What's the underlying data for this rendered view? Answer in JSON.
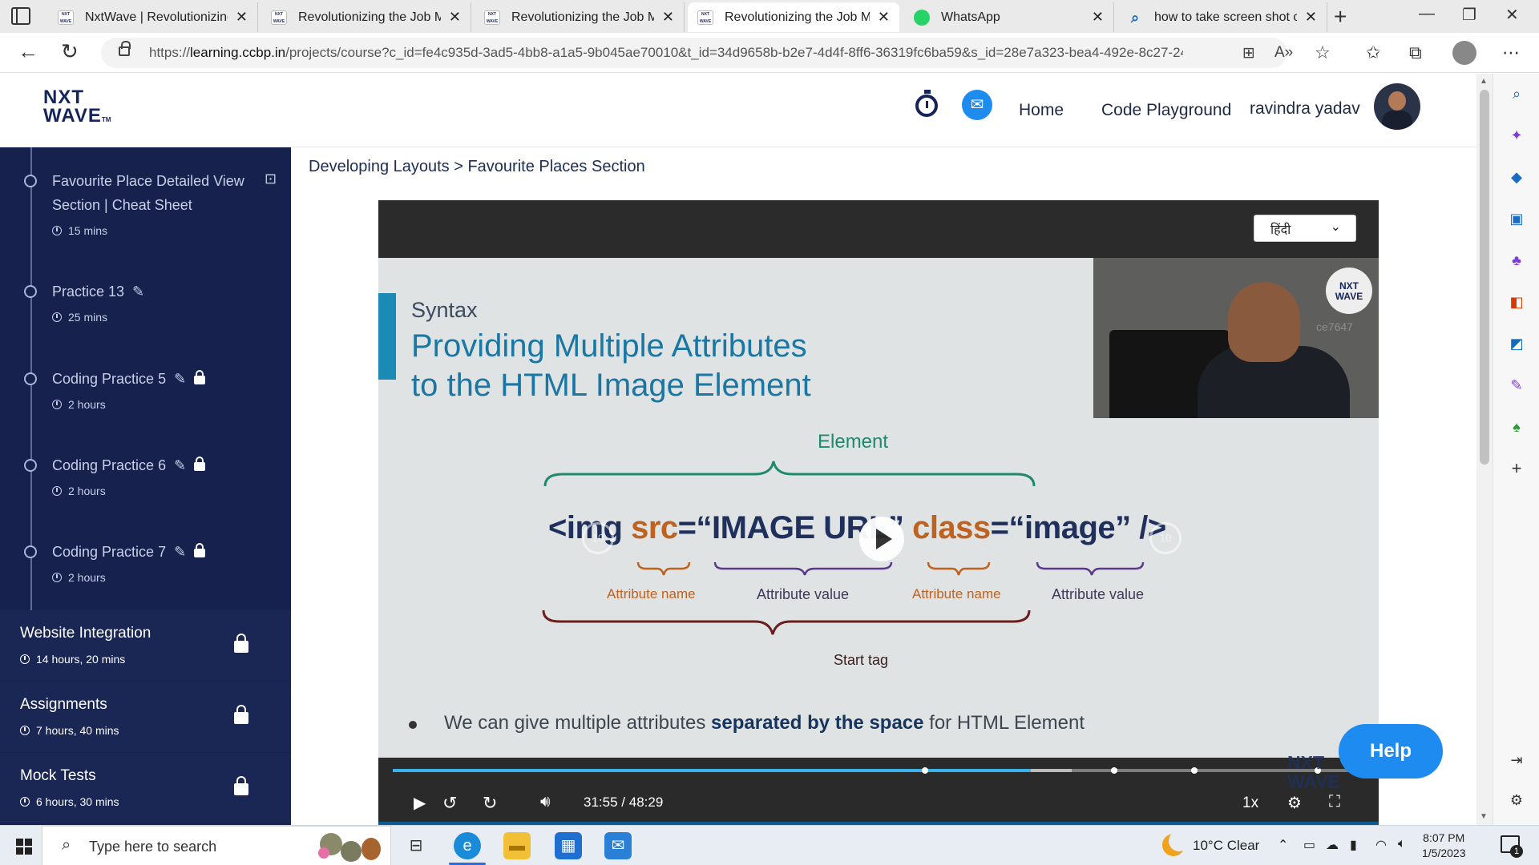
{
  "browser": {
    "tabs": [
      {
        "title": "NxtWave | Revolutionizing th",
        "active": false
      },
      {
        "title": "Revolutionizing the Job Mar",
        "active": false
      },
      {
        "title": "Revolutionizing the Job Mar",
        "active": false
      },
      {
        "title": "Revolutionizing the Job Mar",
        "active": true
      },
      {
        "title": "WhatsApp",
        "active": false
      },
      {
        "title": "how to take screen shot on",
        "active": false
      }
    ],
    "url_prefix": "https://",
    "url_host": "learning.ccbp.in",
    "url_path": "/projects/course?c_id=fe4c935d-3ad5-4bb8-a1a5-9b045ae70010&t_id=34d9658b-b2e7-4d4f-8ff6-36319fc6ba59&s_id=28e7a323-bea4-492e-8c27-24..."
  },
  "header": {
    "logo_line1": "NXT",
    "logo_line2": "WAVE",
    "logo_tm": "TM",
    "nav_home": "Home",
    "nav_playground": "Code Playground",
    "user_name": "ravindra yadav"
  },
  "sidebar": {
    "modules": [
      {
        "title_line1": "Favourite Place Detailed View",
        "title_line2": "Section | Cheat Sheet",
        "duration": "15 mins"
      },
      {
        "title": "Practice 13",
        "duration": "25 mins"
      },
      {
        "title": "Coding Practice 5",
        "duration": "2 hours"
      },
      {
        "title": "Coding Practice 6",
        "duration": "2 hours"
      },
      {
        "title": "Coding Practice 7",
        "duration": "2 hours"
      }
    ],
    "sections": [
      {
        "title": "Website Integration",
        "duration": "14 hours, 20 mins"
      },
      {
        "title": "Assignments",
        "duration": "7 hours, 40 mins"
      },
      {
        "title": "Mock Tests",
        "duration": "6 hours, 30 mins"
      }
    ]
  },
  "content": {
    "breadcrumb": "Developing Layouts > Favourite Places Section"
  },
  "video": {
    "language": "हिंदी",
    "slide": {
      "kicker": "Syntax",
      "heading_line1": "Providing Multiple Attributes",
      "heading_line2": "to the HTML Image Element",
      "element_label": "Element",
      "code_tag_open": "<img ",
      "code_attr1": "src",
      "code_eq1": "=",
      "code_val1": "“IMAGE URL”",
      "code_attr2": " class",
      "code_eq2": "=",
      "code_val2": "“image”",
      "code_tag_close": " />",
      "attr_name_1": "Attribute name",
      "attr_value_1": "Attribute value",
      "attr_name_2": "Attribute name",
      "attr_value_2": "Attribute value",
      "start_tag_label": "Start tag",
      "bullet_pre": "We can give multiple attributes ",
      "bullet_bold": "separated by the space",
      "bullet_post": " for HTML Element",
      "cam_logo_1": "NXT",
      "cam_logo_2": "WAVE",
      "cam_id": "ce7647"
    },
    "current_time": "31:55",
    "time_sep": "/",
    "total_time": "48:29",
    "played_fraction": 0.6578,
    "buffered_fraction": 0.7,
    "speed": "1x",
    "watermark_1": "NXT",
    "watermark_2": "WAVE",
    "skip_seconds": "10"
  },
  "help_label": "Help",
  "taskbar": {
    "search_placeholder": "Type here to search",
    "weather": "10°C  Clear",
    "time": "8:07 PM",
    "date": "1/5/2023",
    "notification_count": "1"
  }
}
